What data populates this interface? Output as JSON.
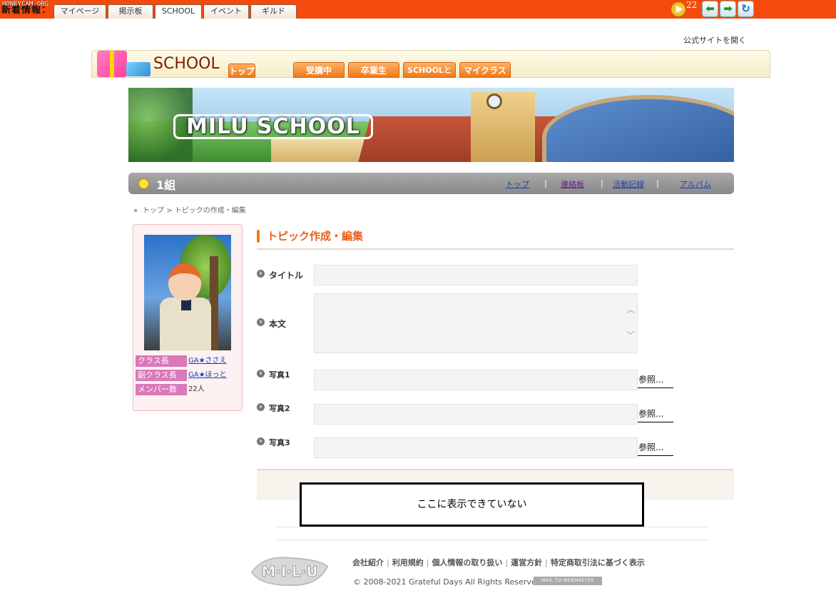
{
  "topbar": {
    "news_label": "新着情報：",
    "watermark": "HONEYCAM.ORG",
    "tabs": [
      "マイページ",
      "掲示板",
      "SCHOOL",
      "イベント",
      "ギルド"
    ],
    "active_tab": "SCHOOL",
    "count": "22"
  },
  "official_link": "公式サイトを開く",
  "schoolnav": {
    "brand": "SCHOOL",
    "tabs": [
      "トップ",
      "受講中",
      "卒業生",
      "SCHOOLとは",
      "マイクラス"
    ]
  },
  "banner": {
    "title": "MILU SCHOOL"
  },
  "classbar": {
    "class_name": "1組",
    "links": [
      "トップ",
      "連絡板",
      "活動記録",
      "アルバム"
    ],
    "separator": "|"
  },
  "breadcrumb": {
    "home": "トップ",
    "separator": ">",
    "current": "トピックの作成・編集"
  },
  "sidebar": {
    "rows": [
      {
        "key": "クラス長",
        "value": "GA★ささえ"
      },
      {
        "key": "副クラス長",
        "value": "GA★ほっと"
      },
      {
        "key": "メンバー数",
        "value": "22人"
      }
    ]
  },
  "form": {
    "heading": "トピック作成・編集",
    "title_label": "タイトル",
    "title_value": "",
    "body_label": "本文",
    "body_value": "",
    "photos": [
      {
        "label": "写真1",
        "button": "参照..."
      },
      {
        "label": "写真2",
        "button": "参照..."
      },
      {
        "label": "写真3",
        "button": "参照..."
      }
    ]
  },
  "notice": "ここに表示できていない",
  "footer": {
    "links": [
      "会社紹介",
      "利用規約",
      "個人情報の取り扱い",
      "運営方針",
      "特定商取引法に基づく表示"
    ],
    "link_separator": "|",
    "copyright": "© 2008-2021 Grateful Days All Rights Reserved.",
    "mail_button": "MAIL TO WEBMASTER",
    "logo_text": "M·I·L·U"
  }
}
